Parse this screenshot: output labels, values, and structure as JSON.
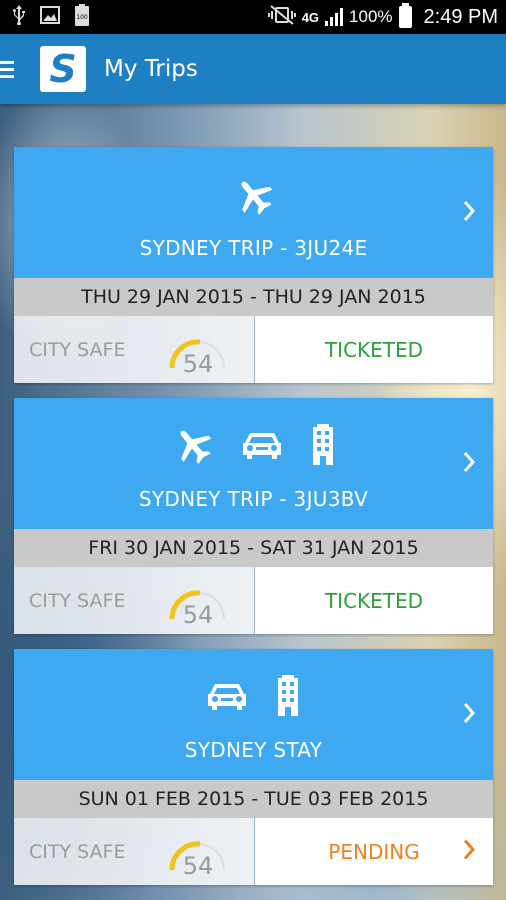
{
  "status_bar": {
    "network": "4G",
    "battery_percent": "100%",
    "time": "2:49 PM",
    "mini_battery_label": "100"
  },
  "app_bar": {
    "logo_letter": "S",
    "title": "My Trips"
  },
  "colors": {
    "app_bar": "#1e7fc3",
    "card_header": "#3ea9f0",
    "ticketed": "#2aa23a",
    "pending": "#f0801d",
    "gauge_arc": "#f2c31b"
  },
  "trips": [
    {
      "icons": [
        "plane-icon"
      ],
      "title": "SYDNEY TRIP - 3JU24E",
      "dates": "THU 29 JAN 2015 - THU 29 JAN 2015",
      "city_safe_label": "CITY SAFE",
      "city_safe_score": "54",
      "status": "TICKETED"
    },
    {
      "icons": [
        "plane-icon",
        "car-icon",
        "hotel-icon"
      ],
      "title": "SYDNEY TRIP - 3JU3BV",
      "dates": "FRI 30 JAN 2015 - SAT 31 JAN 2015",
      "city_safe_label": "CITY SAFE",
      "city_safe_score": "54",
      "status": "TICKETED"
    },
    {
      "icons": [
        "car-icon",
        "hotel-icon"
      ],
      "title": "SYDNEY STAY",
      "dates": "SUN 01 FEB 2015 - TUE 03 FEB 2015",
      "city_safe_label": "CITY SAFE",
      "city_safe_score": "54",
      "status": "PENDING"
    }
  ]
}
